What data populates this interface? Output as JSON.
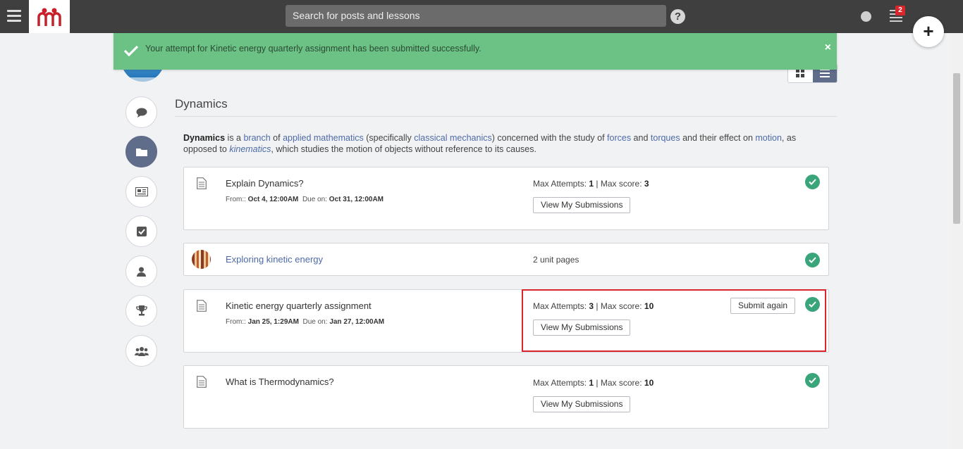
{
  "topbar": {
    "search_placeholder": "Search for posts and lessons",
    "help_label": "?",
    "notification_count": "2",
    "plus_label": "+"
  },
  "banner": {
    "message": "Your attempt for Kinetic energy quarterly assignment has been submitted successfully.",
    "close_label": "×"
  },
  "section": {
    "title": "Dynamics",
    "desc": {
      "term": "Dynamics",
      "t1": " is a ",
      "l1": "branch",
      "t2": " of ",
      "l2": "applied mathematics",
      "t3": " (specifically ",
      "l3": "classical mechanics",
      "t4": ") concerned with the study of ",
      "l4": "forces",
      "t5": " and ",
      "l5": "torques",
      "t6": " and their effect on ",
      "l6": "motion",
      "t7": ", as opposed to ",
      "l7": "kinematics",
      "t8": ", which studies the motion of objects without reference to its causes."
    }
  },
  "items": [
    {
      "title": "Explain Dynamics?",
      "from_label": "From::",
      "from": "Oct 4, 12:00AM",
      "due_label": "Due on:",
      "due": "Oct 31, 12:00AM",
      "attempts_label": "Max Attempts:",
      "attempts": "1",
      "score_label": "Max score:",
      "score": "3",
      "view_label": "View My Submissions"
    },
    {
      "title": "Exploring kinetic energy",
      "pages": "2 unit pages"
    },
    {
      "title": "Kinetic energy quarterly assignment",
      "from_label": "From::",
      "from": "Jan 25, 1:29AM",
      "due_label": "Due on:",
      "due": "Jan 27, 12:00AM",
      "attempts_label": "Max Attempts:",
      "attempts": "3",
      "score_label": "Max score:",
      "score": "10",
      "view_label": "View My Submissions",
      "submit_label": "Submit again"
    },
    {
      "title": "What is Thermodynamics?",
      "attempts_label": "Max Attempts:",
      "attempts": "1",
      "score_label": "Max score:",
      "score": "10",
      "view_label": "View My Submissions"
    }
  ],
  "colors": {
    "topbar": "#3f3f3f",
    "banner": "#6cc285",
    "accent": "#5f6c8a",
    "link": "#4d6aa8",
    "success": "#3aa57a",
    "highlight": "#d9262c"
  }
}
